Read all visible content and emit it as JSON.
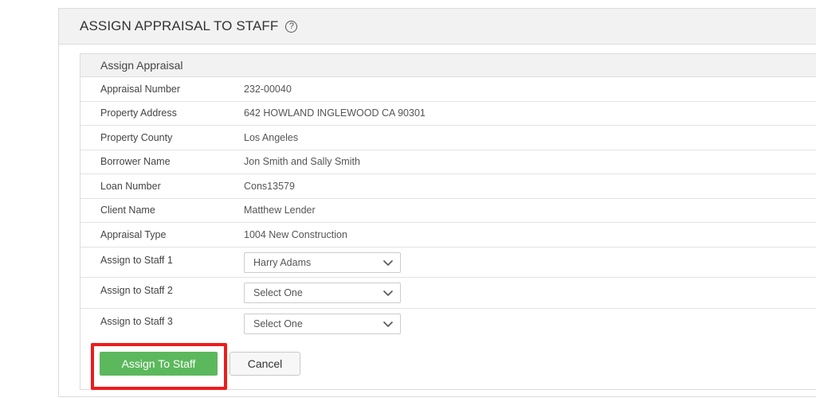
{
  "page": {
    "title": "ASSIGN APPRAISAL TO STAFF",
    "help_symbol": "?"
  },
  "card": {
    "title": "Assign Appraisal",
    "fields": [
      {
        "label": "Appraisal Number",
        "value": "232-00040"
      },
      {
        "label": "Property Address",
        "value": "642 HOWLAND INGLEWOOD CA 90301"
      },
      {
        "label": "Property County",
        "value": "Los Angeles"
      },
      {
        "label": "Borrower Name",
        "value": "Jon Smith and Sally Smith"
      },
      {
        "label": "Loan Number",
        "value": "Cons13579"
      },
      {
        "label": "Client Name",
        "value": "Matthew Lender"
      },
      {
        "label": "Appraisal Type",
        "value": "1004 New Construction"
      }
    ],
    "staff": [
      {
        "label": "Assign to Staff 1",
        "selected": "Harry Adams"
      },
      {
        "label": "Assign to Staff 2",
        "selected": "Select One"
      },
      {
        "label": "Assign to Staff 3",
        "selected": "Select One"
      }
    ]
  },
  "actions": {
    "assign_label": "Assign To Staff",
    "cancel_label": "Cancel"
  },
  "colors": {
    "primary_button": "#5cb85c",
    "highlight": "#ee1c1c",
    "header_bg": "#f2f2f2"
  },
  "icons": {
    "help": "question-circle-icon",
    "dropdown": "chevron-down-icon"
  }
}
